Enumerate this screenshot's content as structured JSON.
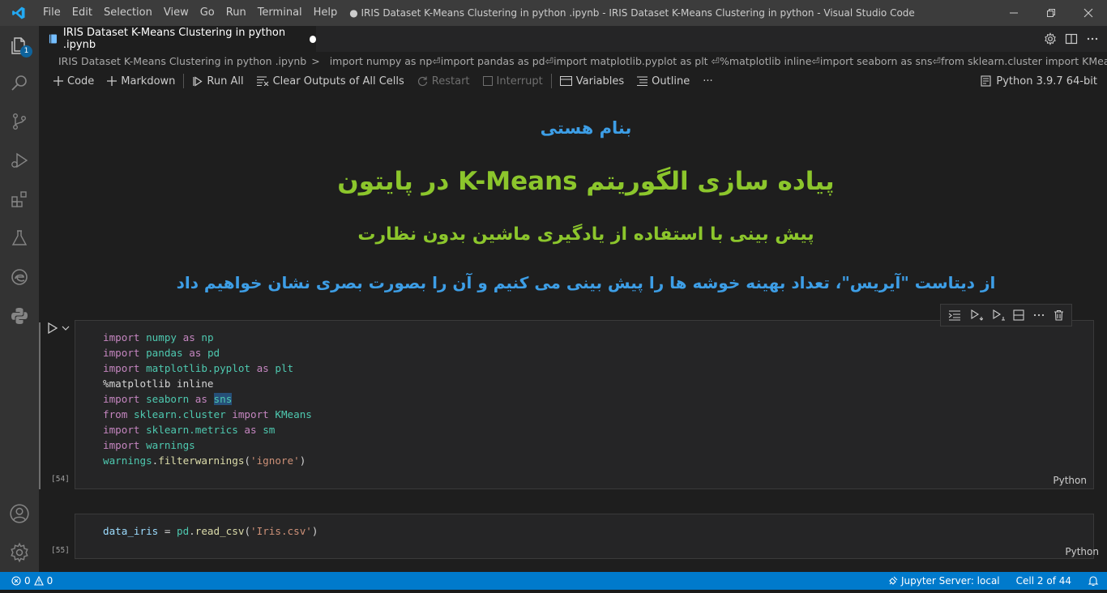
{
  "menu": [
    "File",
    "Edit",
    "Selection",
    "View",
    "Go",
    "Run",
    "Terminal",
    "Help"
  ],
  "window_title": "● IRIS Dataset K-Means Clustering in python .ipynb - IRIS Dataset K-Means Clustering in python - Visual Studio Code",
  "tab": {
    "label": "IRIS Dataset K-Means Clustering in python .ipynb"
  },
  "explorer_badge": "1",
  "breadcrumb": {
    "file": "IRIS Dataset K-Means Clustering in python .ipynb",
    "separator": ">",
    "symbol": "import numpy as np⏎import pandas as pd⏎import matplotlib.pyplot as plt ⏎%matplotlib inline⏎import seaborn as sns⏎from sklearn.cluster import KMeans⏎import sklearn.metrics as sm⏎import warnings⏎warnings.filterwarnings('ignore')"
  },
  "toolbar": {
    "code": "Code",
    "markdown": "Markdown",
    "run_all": "Run All",
    "clear_outputs": "Clear Outputs of All Cells",
    "restart": "Restart",
    "interrupt": "Interrupt",
    "variables": "Variables",
    "outline": "Outline",
    "more": "···",
    "kernel": "Python 3.9.7 64-bit"
  },
  "markdown": {
    "line1": "بنام هستی",
    "line2": "پیاده سازی الگوریتم K-Means در پایتون",
    "line3": "پیش بینی با استفاده از یادگیری ماشین بدون نظارت",
    "line4": "از دیتاست \"آیریس\"، تعداد بهینه خوشه ها را پیش بینی می کنیم و آن را بصورت بصری نشان خواهیم داد"
  },
  "cells": [
    {
      "exec_count": "[54]",
      "language": "Python"
    },
    {
      "exec_count": "[55]",
      "language": "Python"
    }
  ],
  "status": {
    "errors": "0",
    "warnings": "0",
    "jupyter": "Jupyter Server: local",
    "cell": "Cell 2 of 44"
  },
  "colors": {
    "accent": "#007acc",
    "md_blue": "#3d9ee6",
    "md_green": "#8cc62c"
  }
}
